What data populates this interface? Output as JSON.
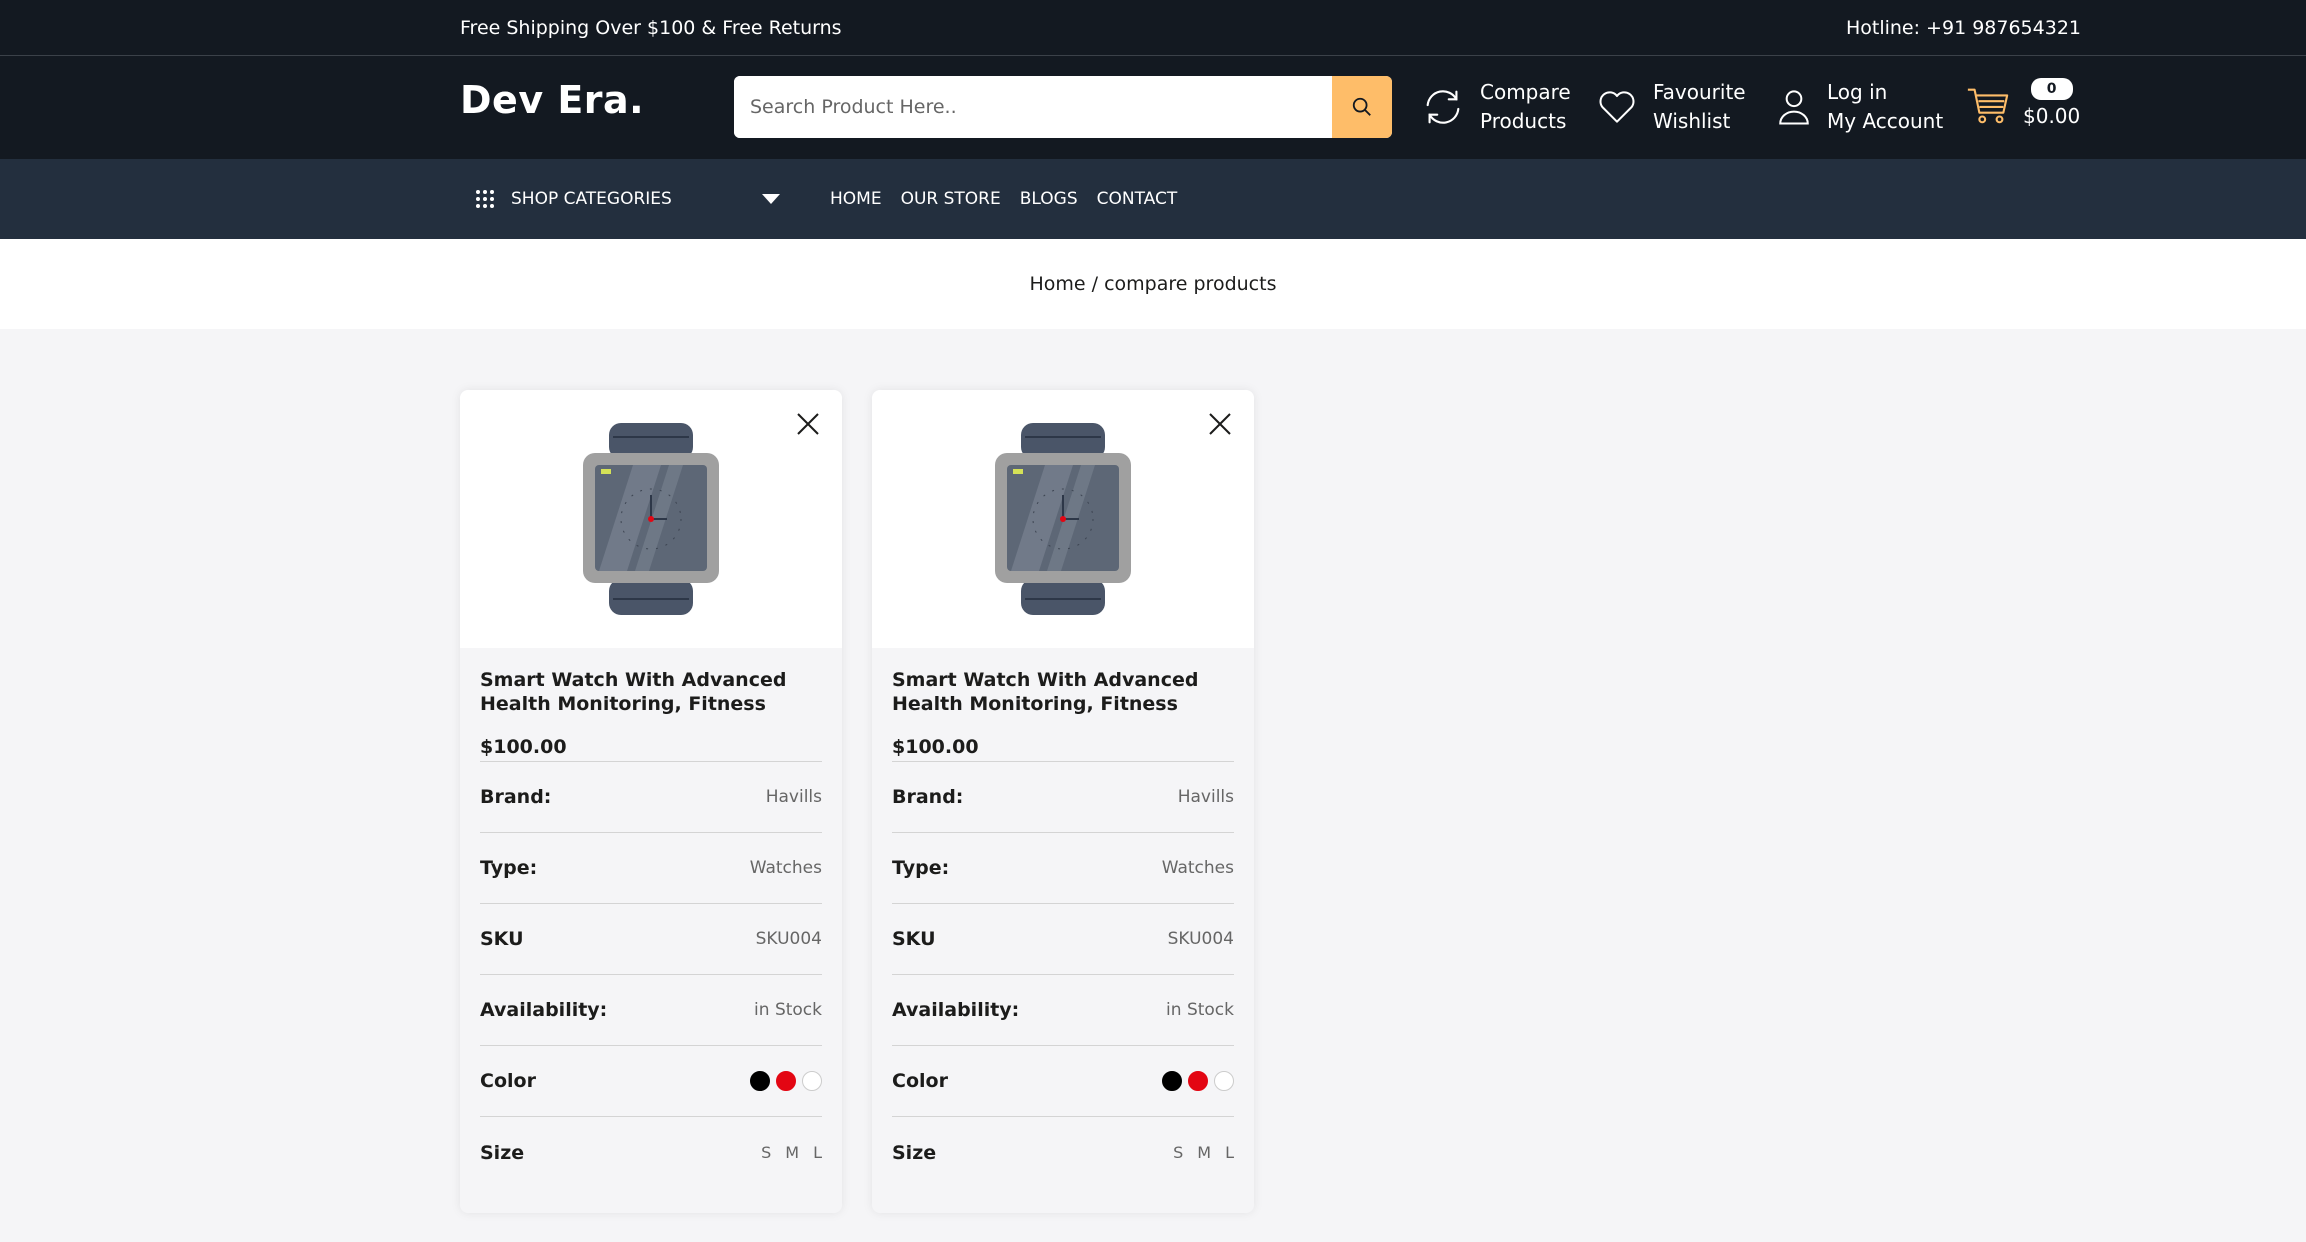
{
  "topbar": {
    "shipping": "Free Shipping Over $100 & Free Returns",
    "hotline": "Hotline: +91 987654321"
  },
  "header": {
    "logo": "Dev Era.",
    "search_placeholder": "Search Product Here..",
    "compare_line1": "Compare",
    "compare_line2": "Products",
    "fav_line1": "Favourite",
    "fav_line2": "Wishlist",
    "account_line1": "Log in",
    "account_line2": "My Account",
    "cart_count": "0",
    "cart_total": "$0.00"
  },
  "nav": {
    "categories": "SHOP CATEGORIES",
    "links": [
      "HOME",
      "OUR STORE",
      "BLOGS",
      "CONTACT"
    ]
  },
  "breadcrumb": "Home / compare products",
  "colors": {
    "accent": "#febd69",
    "header_bg": "#131921",
    "nav_bg": "#232f3e",
    "swatch_black": "#000000",
    "swatch_red": "#e30613",
    "swatch_white": "#ffffff"
  },
  "products": [
    {
      "title": "Smart Watch With Advanced Health Monitoring, Fitness",
      "price": "$100.00",
      "brand_label": "Brand:",
      "brand": "Havills",
      "type_label": "Type:",
      "type": "Watches",
      "sku_label": "SKU",
      "sku": "SKU004",
      "avail_label": "Availability:",
      "availability": "in Stock",
      "color_label": "Color",
      "size_label": "Size",
      "sizes": [
        "S",
        "M",
        "L"
      ]
    },
    {
      "title": "Smart Watch With Advanced Health Monitoring, Fitness",
      "price": "$100.00",
      "brand_label": "Brand:",
      "brand": "Havills",
      "type_label": "Type:",
      "type": "Watches",
      "sku_label": "SKU",
      "sku": "SKU004",
      "avail_label": "Availability:",
      "availability": "in Stock",
      "color_label": "Color",
      "size_label": "Size",
      "sizes": [
        "S",
        "M",
        "L"
      ]
    }
  ]
}
